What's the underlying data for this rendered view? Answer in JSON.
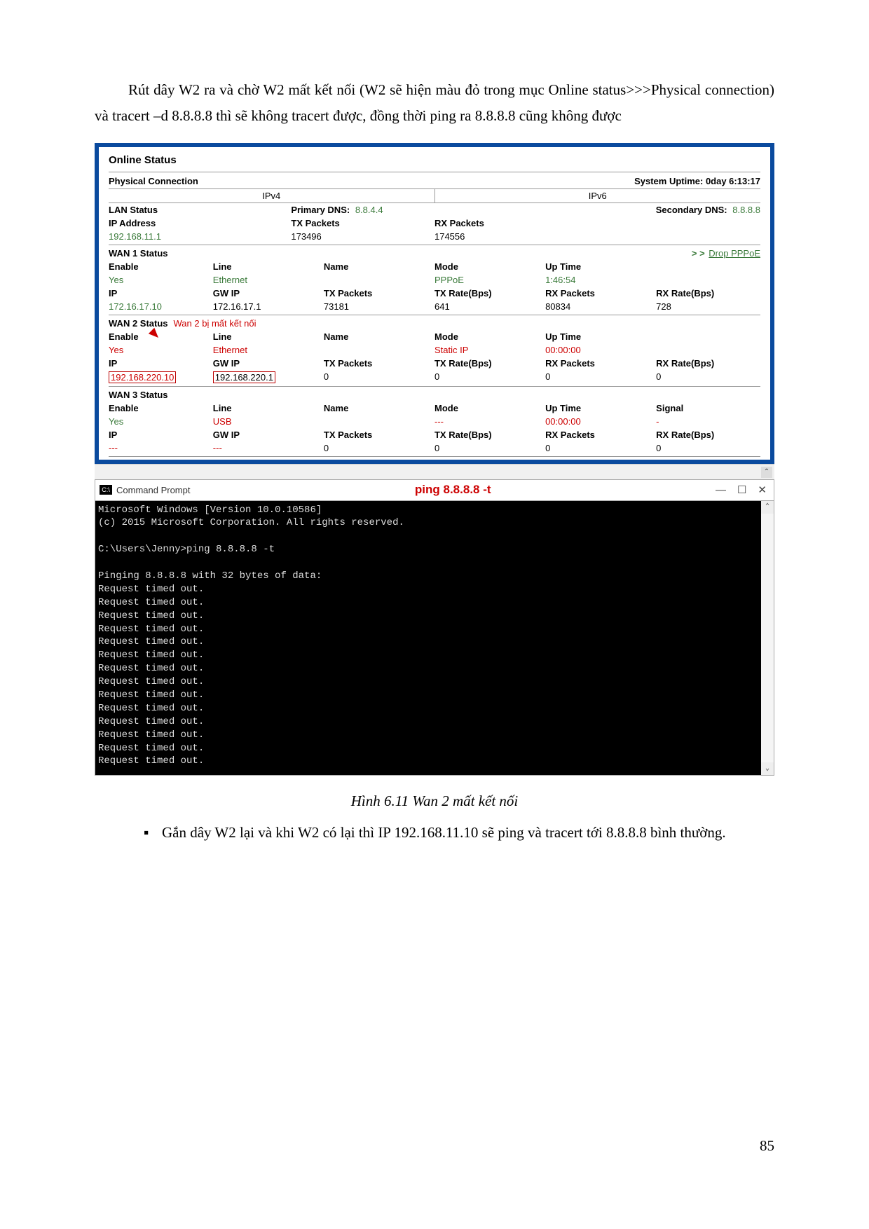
{
  "para1": "Rút dây W2 ra và chờ W2 mất kết nối (W2 sẽ hiện màu đỏ trong mục Online status>>>Physical connection) và tracert –d 8.8.8.8 thì sẽ không tracert được, đồng thời ping ra 8.8.8.8 cũng không được",
  "router": {
    "title": "Online Status",
    "phys_conn": "Physical Connection",
    "uptime_label": "System Uptime: 0day 6:13:17",
    "ipv4": "IPv4",
    "ipv6": "IPv6",
    "lan": {
      "status": "LAN Status",
      "pdns_l": "Primary DNS:",
      "pdns_v": "8.8.4.4",
      "sdns_l": "Secondary DNS:",
      "sdns_v": "8.8.8.8",
      "ip_l": "IP Address",
      "tx_l": "TX Packets",
      "rx_l": "RX Packets",
      "ip_v": "192.168.11.1",
      "tx_v": "173496",
      "rx_v": "174556"
    },
    "wan1": {
      "title": "WAN 1 Status",
      "drop": "Drop PPPoE",
      "drop_pref": "> >",
      "h_enable": "Enable",
      "h_line": "Line",
      "h_name": "Name",
      "h_mode": "Mode",
      "h_up": "Up Time",
      "v_enable": "Yes",
      "v_line": "Ethernet",
      "v_name": "",
      "v_mode": "PPPoE",
      "v_up": "1:46:54",
      "h_ip": "IP",
      "h_gw": "GW IP",
      "h_tx": "TX Packets",
      "h_txr": "TX Rate(Bps)",
      "h_rx": "RX Packets",
      "h_rxr": "RX Rate(Bps)",
      "v_ip": "172.16.17.10",
      "v_gw": "172.16.17.1",
      "v_tx": "73181",
      "v_txr": "641",
      "v_rx": "80834",
      "v_rxr": "728"
    },
    "wan2": {
      "title": "WAN 2 Status",
      "annot": "Wan 2 bị mất kết nối",
      "h_enable": "Enable",
      "h_line": "Line",
      "h_name": "Name",
      "h_mode": "Mode",
      "h_up": "Up Time",
      "v_enable": "Yes",
      "v_line": "Ethernet",
      "v_name": "",
      "v_mode": "Static IP",
      "v_up": "00:00:00",
      "h_ip": "IP",
      "h_gw": "GW IP",
      "h_tx": "TX Packets",
      "h_txr": "TX Rate(Bps)",
      "h_rx": "RX Packets",
      "h_rxr": "RX Rate(Bps)",
      "v_ip": "192.168.220.10",
      "v_gw": "192.168.220.1",
      "v_tx": "0",
      "v_txr": "0",
      "v_rx": "0",
      "v_rxr": "0"
    },
    "wan3": {
      "title": "WAN 3 Status",
      "h_enable": "Enable",
      "h_line": "Line",
      "h_name": "Name",
      "h_mode": "Mode",
      "h_up": "Up Time",
      "h_sig": "Signal",
      "v_enable": "Yes",
      "v_line": "USB",
      "v_name": "",
      "v_mode": "---",
      "v_up": "00:00:00",
      "v_sig": "-",
      "h_ip": "IP",
      "h_gw": "GW IP",
      "h_tx": "TX Packets",
      "h_txr": "TX Rate(Bps)",
      "h_rx": "RX Packets",
      "h_rxr": "RX Rate(Bps)",
      "v_ip": "---",
      "v_gw": "---",
      "v_tx": "0",
      "v_txr": "0",
      "v_rx": "0",
      "v_rxr": "0"
    }
  },
  "cmd": {
    "icon": "C:\\",
    "label": "Command Prompt",
    "ping": "ping 8.8.8.8 -t",
    "min": "—",
    "max": "☐",
    "close": "✕",
    "body": "Microsoft Windows [Version 10.0.10586]\n(c) 2015 Microsoft Corporation. All rights reserved.\n\nC:\\Users\\Jenny>ping 8.8.8.8 -t\n\nPinging 8.8.8.8 with 32 bytes of data:\nRequest timed out.\nRequest timed out.\nRequest timed out.\nRequest timed out.\nRequest timed out.\nRequest timed out.\nRequest timed out.\nRequest timed out.\nRequest timed out.\nRequest timed out.\nRequest timed out.\nRequest timed out.\nRequest timed out.\nRequest timed out."
  },
  "caption": "Hình 6.11 Wan 2 mất kết nối",
  "bullet": "Gắn dây W2 lại và khi W2 có lại thì IP 192.168.11.10 sẽ ping và tracert tới 8.8.8.8 bình thường.",
  "page_num": "85"
}
